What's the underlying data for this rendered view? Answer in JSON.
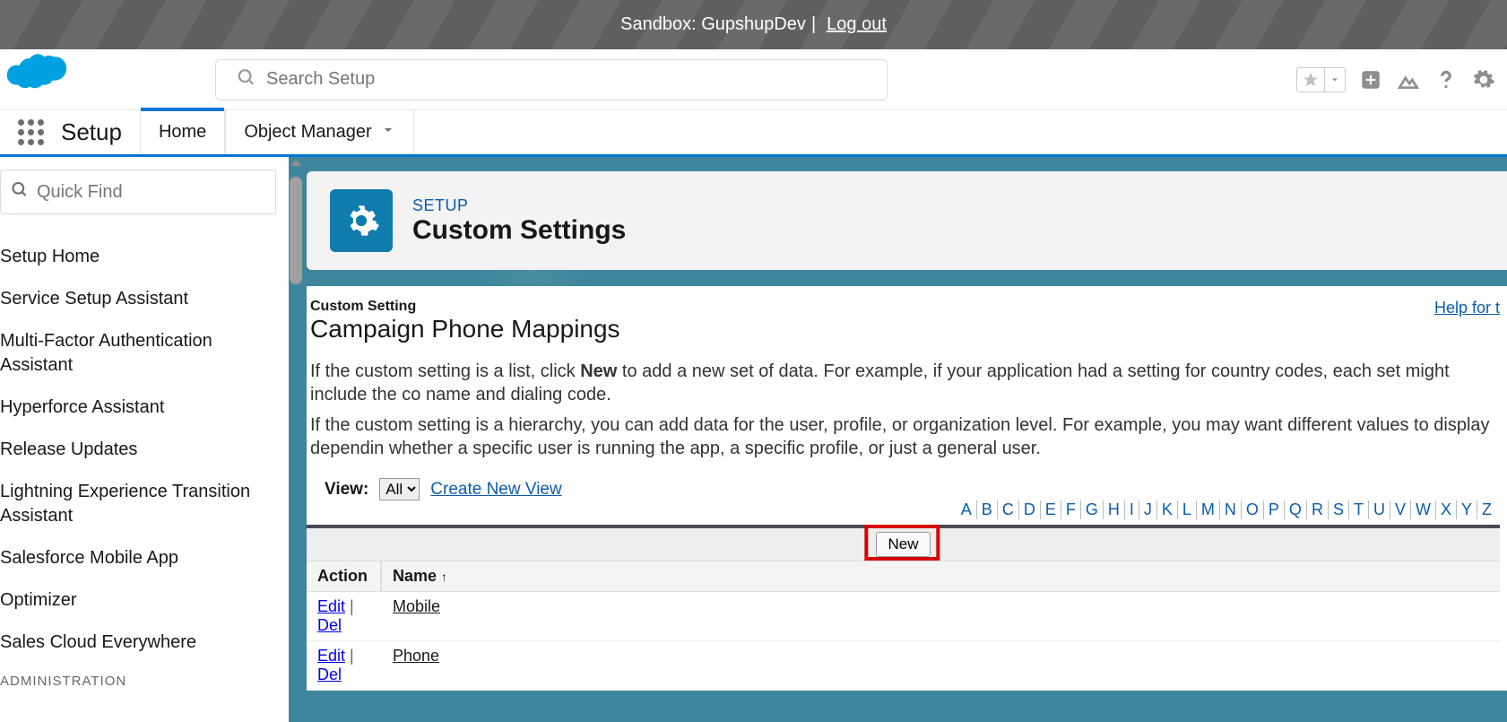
{
  "sandbox": {
    "label": "Sandbox: GupshupDev",
    "logout": "Log out"
  },
  "search": {
    "placeholder": "Search Setup"
  },
  "context": {
    "app_name": "Setup",
    "tabs": [
      {
        "label": "Home"
      },
      {
        "label": "Object Manager"
      }
    ]
  },
  "quickfind": {
    "placeholder": "Quick Find"
  },
  "sidebar_items": [
    "Setup Home",
    "Service Setup Assistant",
    "Multi-Factor Authentication Assistant",
    "Hyperforce Assistant",
    "Release Updates",
    "Lightning Experience Transition Assistant",
    "Salesforce Mobile App",
    "Optimizer",
    "Sales Cloud Everywhere",
    "ADMINISTRATION"
  ],
  "page_header": {
    "eyebrow": "SETUP",
    "title": "Custom Settings"
  },
  "content": {
    "overline": "Custom Setting",
    "heading": "Campaign Phone Mappings",
    "help": "Help for t",
    "p1_pre": "If the custom setting is a list, click ",
    "p1_bold": "New",
    "p1_post": " to add a new set of data. For example, if your application had a setting for country codes, each set might include the co name and dialing code.",
    "p2": "If the custom setting is a hierarchy, you can add data for the user, profile, or organization level. For example, you may want different values to display dependin whether a specific user is running the app, a specific profile, or just a general user.",
    "view_label": "View:",
    "view_selected": "All",
    "create_view": "Create New View"
  },
  "alpha": [
    "A",
    "B",
    "C",
    "D",
    "E",
    "F",
    "G",
    "H",
    "I",
    "J",
    "K",
    "L",
    "M",
    "N",
    "O",
    "P",
    "Q",
    "R",
    "S",
    "T",
    "U",
    "V",
    "W",
    "X",
    "Y",
    "Z"
  ],
  "table": {
    "new_label": "New",
    "columns": {
      "action": "Action",
      "name": "Name"
    },
    "action_edit": "Edit",
    "action_del": "Del",
    "rows": [
      {
        "name": "Mobile"
      },
      {
        "name": "Phone"
      }
    ]
  }
}
